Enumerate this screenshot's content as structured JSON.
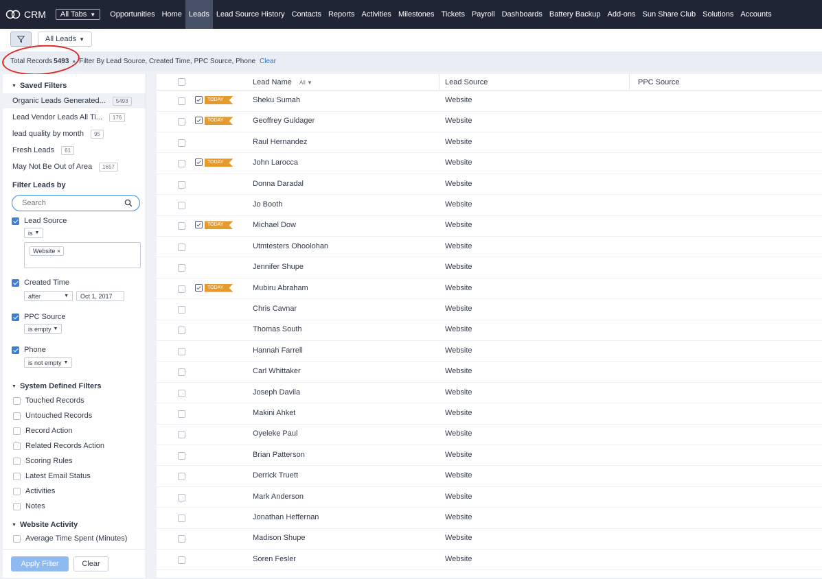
{
  "nav": {
    "logo": "CRM",
    "all_tabs": "All Tabs",
    "tabs": [
      "Opportunities",
      "Home",
      "Leads",
      "Lead Source History",
      "Contacts",
      "Reports",
      "Activities",
      "Milestones",
      "Tickets",
      "Payroll",
      "Dashboards",
      "Battery Backup",
      "Add-ons",
      "Sun Share Club",
      "Solutions",
      "Accounts"
    ],
    "active_tab": "Leads"
  },
  "toolbar": {
    "view": "All Leads"
  },
  "summary": {
    "total_label": "Total Records",
    "total_count": "5493",
    "filter_text": "Filter By Lead Source, Created Time, PPC Source, Phone",
    "clear": "Clear"
  },
  "sidebar": {
    "saved_filters_title": "Saved Filters",
    "saved_filters": [
      {
        "label": "Organic Leads Generated...",
        "count": "5493"
      },
      {
        "label": "Lead Vendor Leads All Ti...",
        "count": "176"
      },
      {
        "label": "lead quality by month",
        "count": "95"
      },
      {
        "label": "Fresh Leads",
        "count": "61"
      },
      {
        "label": "May Not Be Out of Area",
        "count": "1657"
      }
    ],
    "filter_leads_by": "Filter Leads by",
    "search_placeholder": "Search",
    "criteria": {
      "lead_source": {
        "label": "Lead Source",
        "op": "is",
        "tag": "Website"
      },
      "created_time": {
        "label": "Created Time",
        "op": "after",
        "date": "Oct 1, 2017"
      },
      "ppc_source": {
        "label": "PPC Source",
        "op": "is empty"
      },
      "phone": {
        "label": "Phone",
        "op": "is not empty"
      }
    },
    "system_filters_title": "System Defined Filters",
    "system_filters": [
      "Touched Records",
      "Untouched Records",
      "Record Action",
      "Related Records Action",
      "Scoring Rules",
      "Latest Email Status",
      "Activities",
      "Notes"
    ],
    "website_activity_title": "Website Activity",
    "website_activity": [
      "Average Time Spent (Minutes)"
    ],
    "apply_button": "Apply Filter",
    "clear_button": "Clear"
  },
  "table": {
    "headers": {
      "lead_name": "Lead Name",
      "all": "All",
      "lead_source": "Lead Source",
      "ppc_source": "PPC Source"
    },
    "today_label": "TODAY",
    "rows": [
      {
        "name": "Sheku Sumah",
        "source": "Website",
        "today": true
      },
      {
        "name": "Geoffrey Guldager",
        "source": "Website",
        "today": true
      },
      {
        "name": "Raul Hernandez",
        "source": "Website",
        "today": false
      },
      {
        "name": "John Larocca",
        "source": "Website",
        "today": true
      },
      {
        "name": "Donna Daradal",
        "source": "Website",
        "today": false
      },
      {
        "name": "Jo Booth",
        "source": "Website",
        "today": false
      },
      {
        "name": "Michael Dow",
        "source": "Website",
        "today": true
      },
      {
        "name": "Utmtesters Ohoolohan",
        "source": "Website",
        "today": false
      },
      {
        "name": "Jennifer Shupe",
        "source": "Website",
        "today": false
      },
      {
        "name": "Mubiru Abraham",
        "source": "Website",
        "today": true
      },
      {
        "name": "Chris Cavnar",
        "source": "Website",
        "today": false
      },
      {
        "name": "Thomas South",
        "source": "Website",
        "today": false
      },
      {
        "name": "Hannah Farrell",
        "source": "Website",
        "today": false
      },
      {
        "name": "Carl Whittaker",
        "source": "Website",
        "today": false
      },
      {
        "name": "Joseph Davila",
        "source": "Website",
        "today": false
      },
      {
        "name": "Makini Ahket",
        "source": "Website",
        "today": false
      },
      {
        "name": "Oyeleke Paul",
        "source": "Website",
        "today": false
      },
      {
        "name": "Brian Patterson",
        "source": "Website",
        "today": false
      },
      {
        "name": "Derrick Truett",
        "source": "Website",
        "today": false
      },
      {
        "name": "Mark Anderson",
        "source": "Website",
        "today": false
      },
      {
        "name": "Jonathan Heffernan",
        "source": "Website",
        "today": false
      },
      {
        "name": "Madison Shupe",
        "source": "Website",
        "today": false
      },
      {
        "name": "Soren Fesler",
        "source": "Website",
        "today": false
      }
    ]
  },
  "colors": {
    "nav_bg": "#1f2535",
    "accent": "#3b7fd9",
    "today_badge": "#e69a2c",
    "annotation": "#e12626"
  }
}
